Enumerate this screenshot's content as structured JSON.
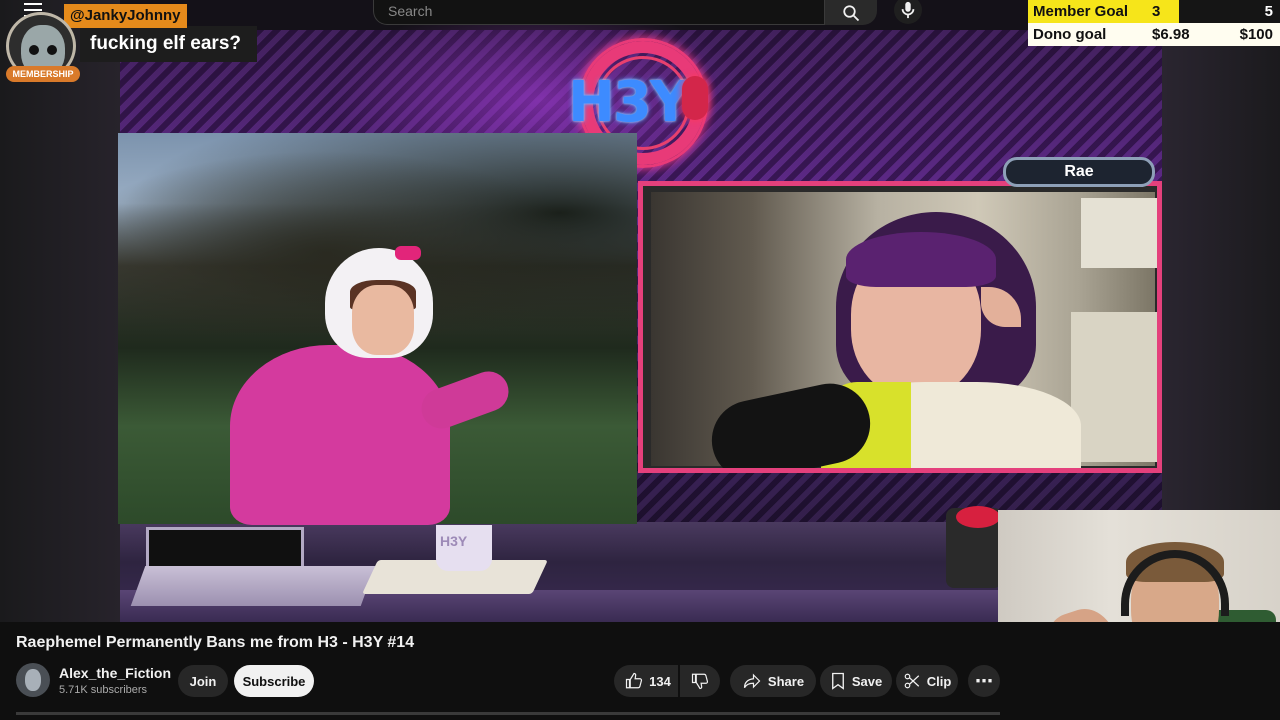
{
  "search": {
    "placeholder": "Search"
  },
  "chat": {
    "username": "@JankyJohnny",
    "badge": "MEMBERSHIP",
    "message": "fucking elf ears?"
  },
  "goals": {
    "member": {
      "label": "Member Goal",
      "current": "3",
      "target": "5",
      "progress": 0.6
    },
    "dono": {
      "label": "Dono goal",
      "current": "$6.98",
      "target": "$100",
      "progress": 0.07
    }
  },
  "stream": {
    "logo": "H3Y",
    "guest_name": "Rae",
    "mug_text": "H3Y"
  },
  "video": {
    "title": "Raephemel Permanently Bans me from H3 - H3Y #14"
  },
  "channel": {
    "name": "Alex_the_Fiction",
    "subscribers": "5.71K subscribers",
    "join_label": "Join",
    "subscribe_label": "Subscribe"
  },
  "actions": {
    "likes": "134",
    "share": "Share",
    "save": "Save",
    "clip": "Clip",
    "more": "⋯"
  },
  "icons": [
    "menu-icon",
    "search-icon",
    "mic-icon",
    "thumbs-up-icon",
    "thumbs-down-icon",
    "share-icon",
    "bookmark-icon",
    "scissors-icon",
    "more-icon"
  ],
  "colors": {
    "accent_yellow": "#f6e51a",
    "chat_user_bg": "#e58a1b",
    "frame_pink": "#e4407c"
  }
}
